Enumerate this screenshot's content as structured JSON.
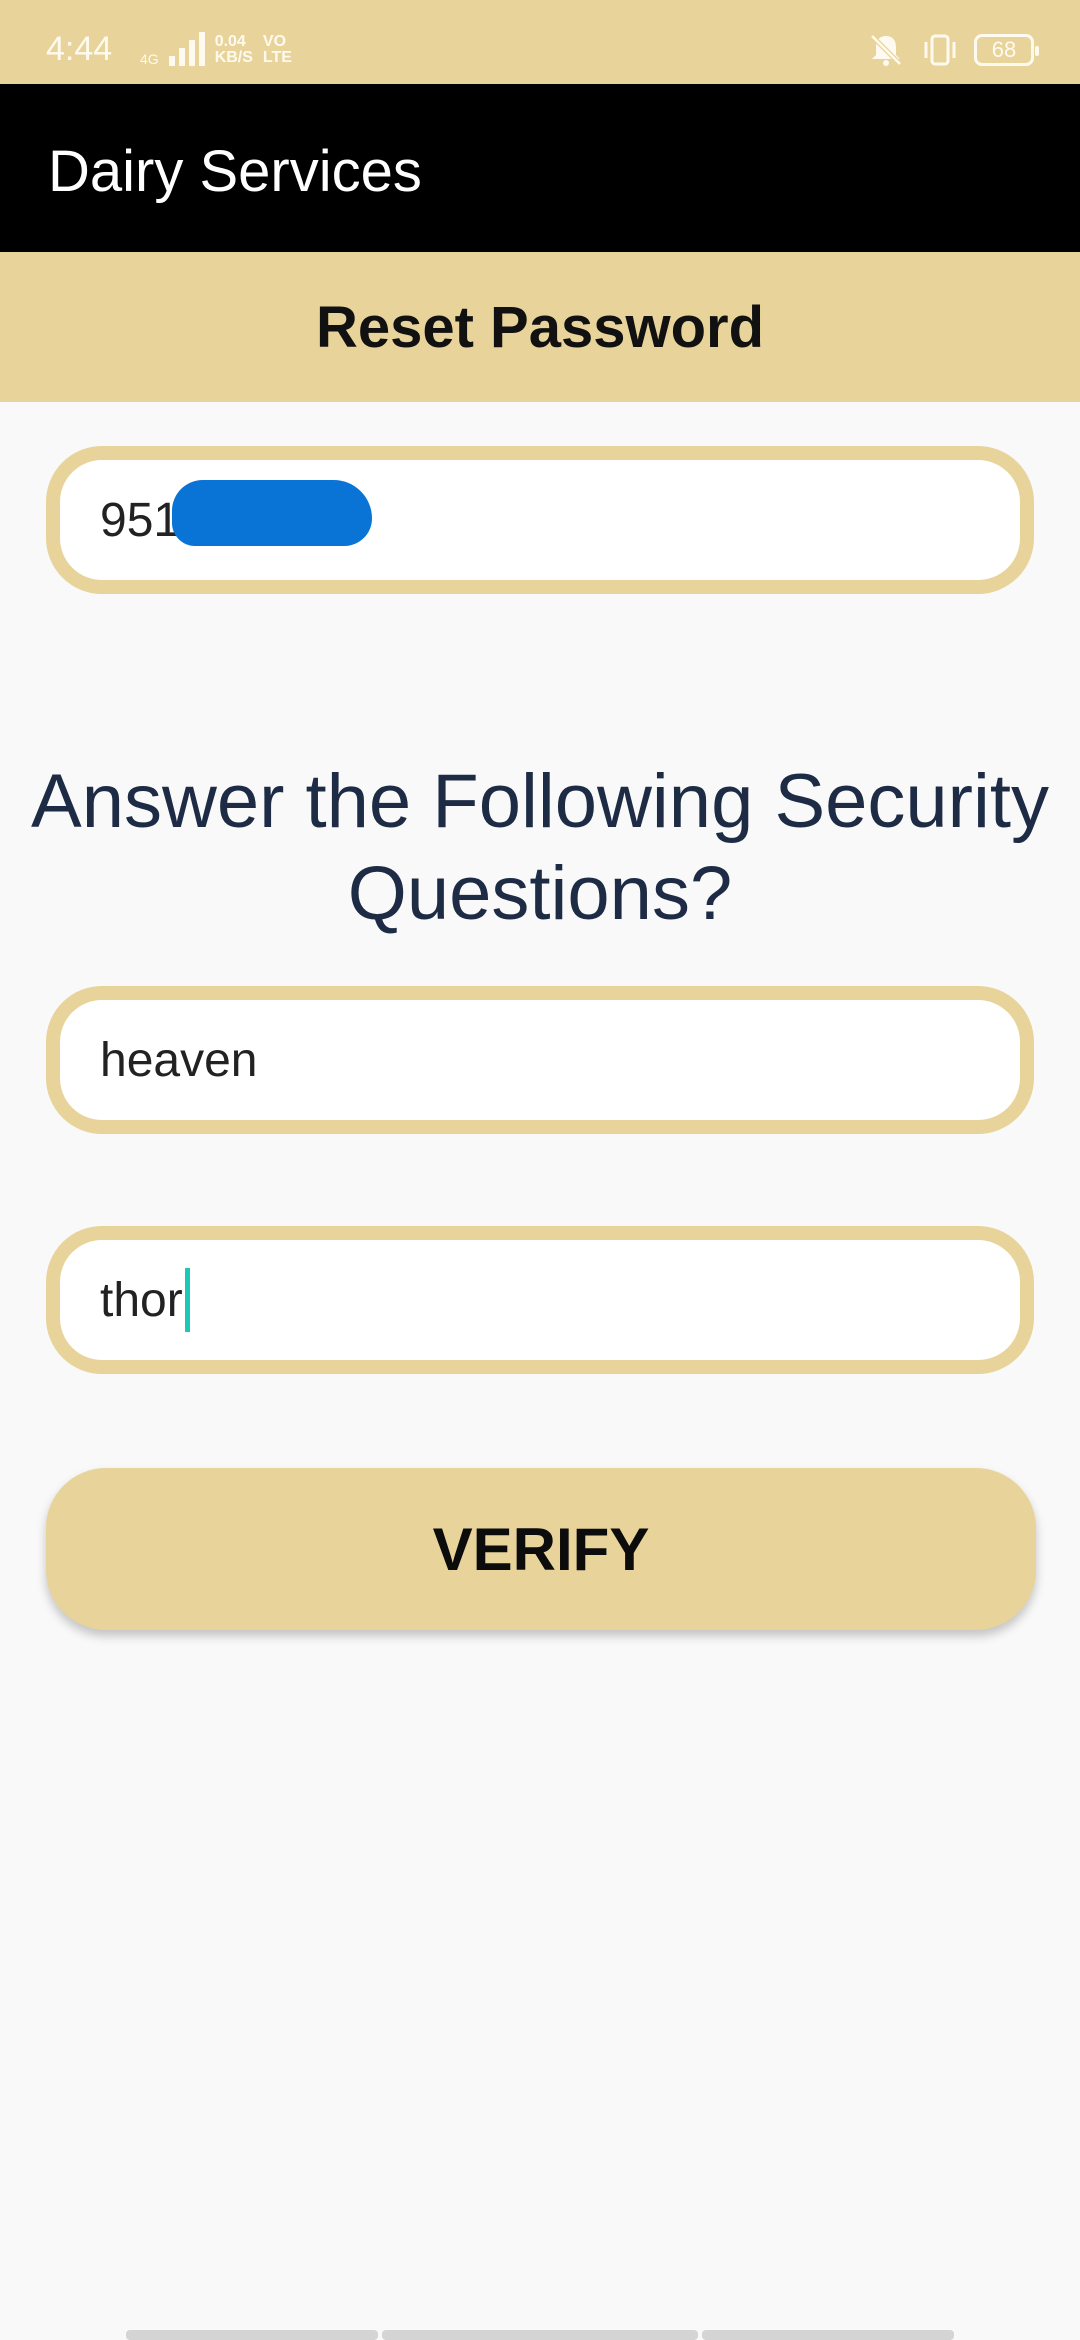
{
  "status_bar": {
    "time": "4:44",
    "network_type": "4G",
    "speed_value": "0.04",
    "speed_unit": "KB/S",
    "volte_top": "VO",
    "volte_bottom": "LTE",
    "battery": "68"
  },
  "app_bar": {
    "title": "Dairy Services"
  },
  "page": {
    "title": "Reset Password"
  },
  "form": {
    "phone_field": {
      "value": "951"
    },
    "security_heading": "Answer the Following Security Questions?",
    "answer_1": {
      "value": "heaven"
    },
    "answer_2": {
      "value": "thor"
    },
    "verify_label": "VERIFY"
  },
  "colors": {
    "accent": "#e8d49a",
    "app_bar": "#000000",
    "heading_text": "#1d2b45",
    "caret": "#1cc9b6",
    "redaction": "#0a74d6"
  }
}
